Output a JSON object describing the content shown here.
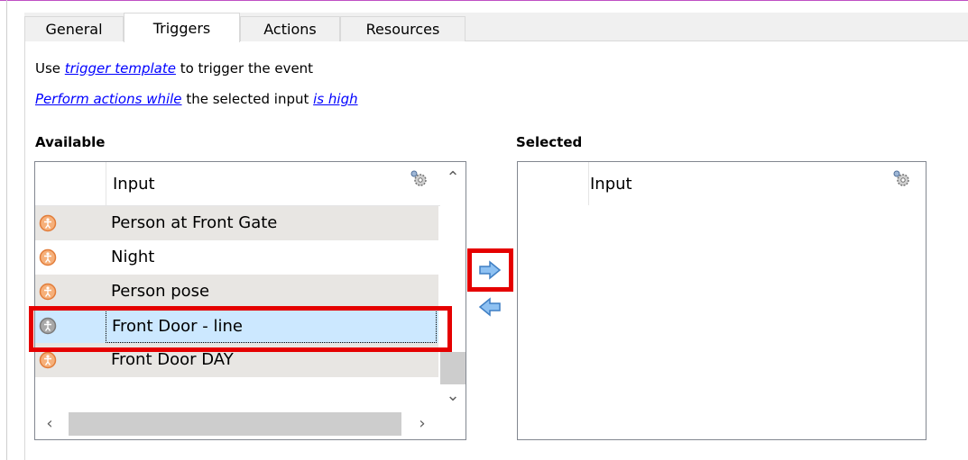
{
  "tabs": [
    {
      "label": "General"
    },
    {
      "label": "Triggers",
      "active": true
    },
    {
      "label": "Actions"
    },
    {
      "label": "Resources"
    }
  ],
  "trigger_line": {
    "prefix": "Use ",
    "link": "trigger template",
    "suffix": " to trigger the event"
  },
  "perform_line": {
    "link1": "Perform actions while",
    "middle": " the selected input ",
    "link2": "is high"
  },
  "available": {
    "heading": "Available",
    "column_header": "Input",
    "items": [
      {
        "label": "Person at Front Gate",
        "icon": "person-orange-icon"
      },
      {
        "label": "Night",
        "icon": "person-orange-icon"
      },
      {
        "label": "Person pose",
        "icon": "person-orange-icon"
      },
      {
        "label": "Front Door - line",
        "icon": "person-grey-icon",
        "selected": true
      },
      {
        "label": "Front Door DAY",
        "icon": "person-orange-icon"
      }
    ]
  },
  "selected_list": {
    "heading": "Selected",
    "column_header": "Input",
    "items": []
  },
  "colors": {
    "link": "#0000ff",
    "selection": "#cce8ff",
    "highlight_box": "#e50000",
    "icon_orange": "#f0a060",
    "icon_grey": "#8c8c8c",
    "arrow_blue": "#4a90e2"
  },
  "icons": {
    "settings": "gear-icon",
    "add": "arrow-right-icon",
    "remove": "arrow-left-icon"
  }
}
